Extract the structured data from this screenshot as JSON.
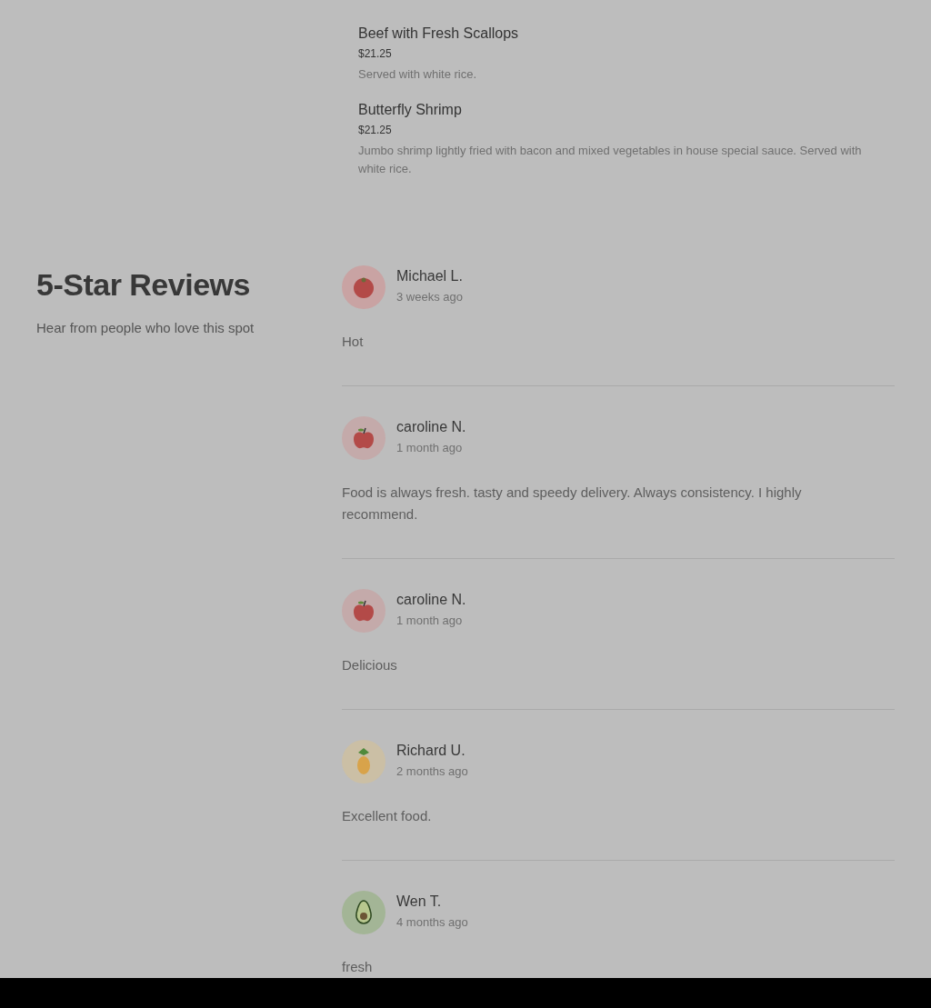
{
  "menu_items": [
    {
      "name": "Beef with Fresh Scallops",
      "price": "$21.25",
      "description": "Served with white rice."
    },
    {
      "name": "Butterfly Shrimp",
      "price": "$21.25",
      "description": "Jumbo shrimp lightly fried with bacon and mixed vegetables in house special sauce. Served with white rice."
    }
  ],
  "reviews_section": {
    "title": "5-Star Reviews",
    "subtitle": "Hear from people who love this spot"
  },
  "reviews": [
    {
      "avatar": {
        "kind": "tomato"
      },
      "name": "Michael L.",
      "time": "3 weeks ago",
      "text": "Hot"
    },
    {
      "avatar": {
        "kind": "apple"
      },
      "name": "caroline N.",
      "time": "1 month ago",
      "text": "Food is always fresh. tasty and speedy delivery. Always consistency. I highly recommend."
    },
    {
      "avatar": {
        "kind": "apple"
      },
      "name": "caroline N.",
      "time": "1 month ago",
      "text": "Delicious"
    },
    {
      "avatar": {
        "kind": "pineapple"
      },
      "name": "Richard U.",
      "time": "2 months ago",
      "text": "Excellent food."
    },
    {
      "avatar": {
        "kind": "avocado"
      },
      "name": "Wen T.",
      "time": "4 months ago",
      "text": "fresh"
    }
  ]
}
